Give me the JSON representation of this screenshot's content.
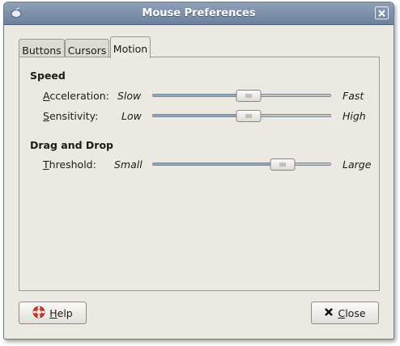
{
  "window": {
    "title": "Mouse Preferences"
  },
  "tabs": [
    {
      "label": "Buttons",
      "active": false
    },
    {
      "label": "Cursors",
      "active": false
    },
    {
      "label": "Motion",
      "active": true
    }
  ],
  "speed": {
    "heading": "Speed",
    "acceleration": {
      "mnemonic": "A",
      "rest": "cceleration:",
      "min_label": "Slow",
      "max_label": "Fast",
      "value_fraction": 0.54
    },
    "sensitivity": {
      "mnemonic": "S",
      "rest": "ensitivity:",
      "min_label": "Low",
      "max_label": "High",
      "value_fraction": 0.54
    }
  },
  "drag_drop": {
    "heading": "Drag and Drop",
    "threshold": {
      "mnemonic": "T",
      "rest": "hreshold:",
      "min_label": "Small",
      "max_label": "Large",
      "value_fraction": 0.73
    }
  },
  "buttons": {
    "help": {
      "mnemonic": "H",
      "rest": "elp"
    },
    "close": {
      "mnemonic": "C",
      "rest": "lose"
    }
  },
  "icons": {
    "window_menu": "mouse-icon",
    "titlebar_close": "close-icon",
    "help": "lifebuoy-icon",
    "close": "x-icon"
  },
  "colors": {
    "titlebar": "#7d8fa9",
    "slider_fill": "#8ea6bf",
    "help_icon_red": "#d9352b"
  }
}
